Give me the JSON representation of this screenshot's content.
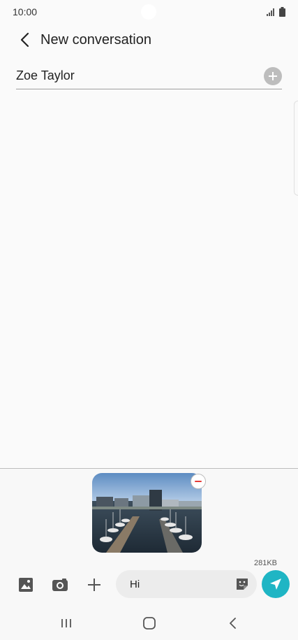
{
  "status_bar": {
    "time": "10:00"
  },
  "header": {
    "title": "New conversation"
  },
  "recipient": {
    "name": "Zoe Taylor"
  },
  "attachment": {
    "image_icon": "harbor-photo",
    "size": "281KB"
  },
  "composer": {
    "message": "Hi"
  },
  "colors": {
    "send_button": "#1fb5c4",
    "remove_minus": "#e53935"
  }
}
